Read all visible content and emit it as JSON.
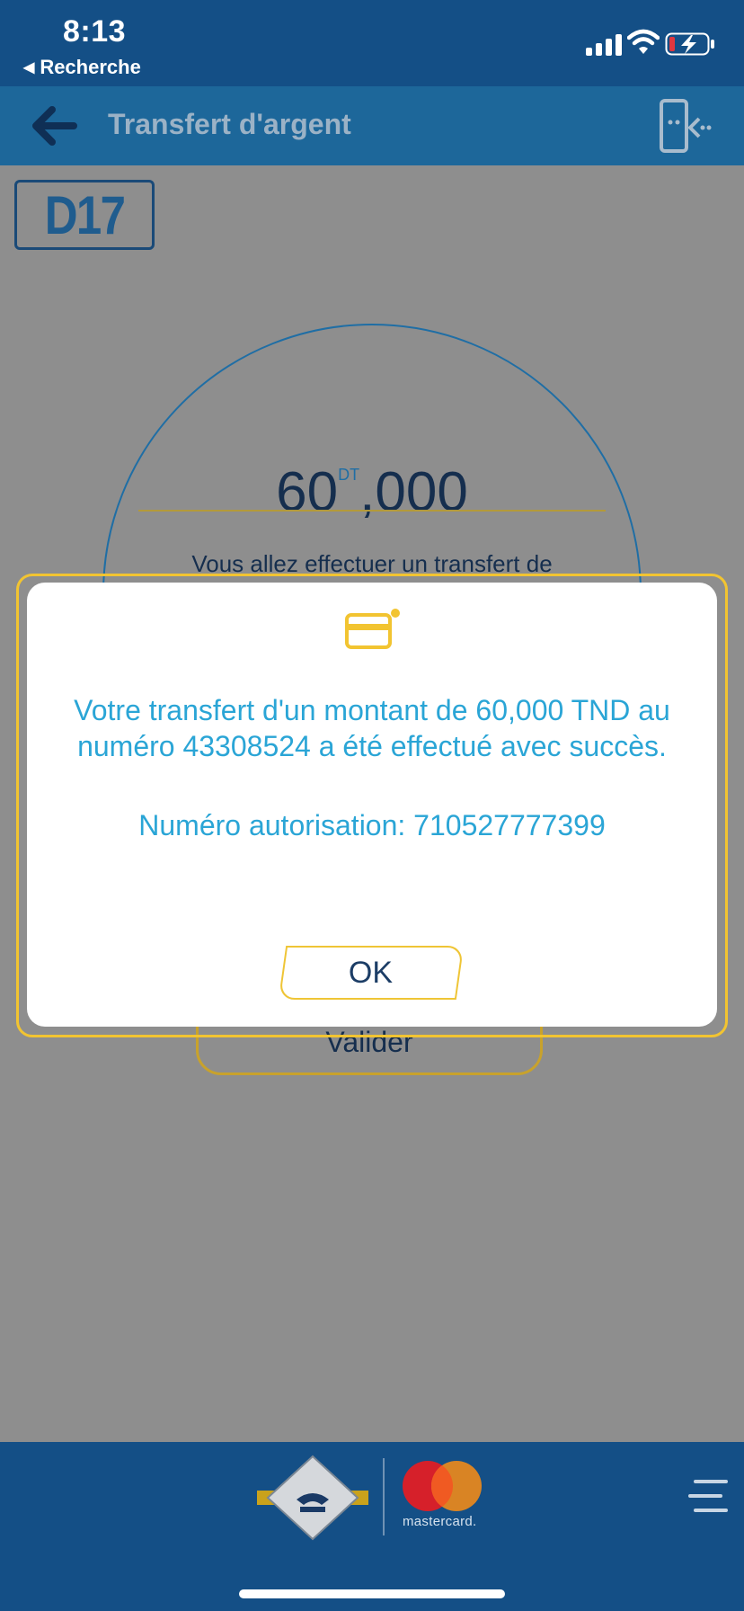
{
  "status_bar": {
    "time": "8:13",
    "back_app": "Recherche"
  },
  "header": {
    "title": "Transfert d'argent"
  },
  "logo": {
    "text": "D17"
  },
  "amount": {
    "whole": "60",
    "currency": "DT",
    "decimals": ",000"
  },
  "info_text": "Vous allez effectuer un transfert de",
  "validate_label": "Valider",
  "modal": {
    "message": "Votre transfert d'un montant de 60,000 TND au numéro 43308524 a été effectué avec succès.",
    "authorization": "Numéro autorisation: 710527777399",
    "ok_label": "OK"
  },
  "footer": {
    "partner_label": "mastercard."
  },
  "colors": {
    "status_bar": "#144f86",
    "header": "#1d679a",
    "accent_yellow": "#f2c431",
    "modal_text": "#2aa5d6",
    "overlay": "#8e8e8e"
  }
}
